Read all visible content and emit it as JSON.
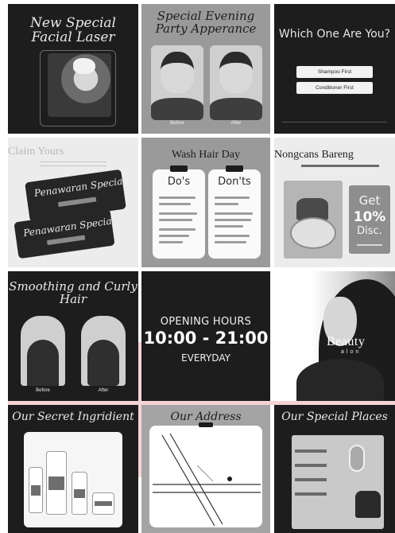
{
  "colors": {
    "dark_tile": "#1d1d1d",
    "mid_tile": "#9a9a9a",
    "light_tile": "#ececec",
    "accent_pink": "#f4d3d6"
  },
  "tiles": {
    "laser": {
      "title": "New Special Facial Laser"
    },
    "evening": {
      "title": "Special Evening Party Apperance",
      "before": "Before",
      "after": "After"
    },
    "which": {
      "title": "Which One Are You?",
      "option_1": "Shampoo First",
      "option_2": "Conditioner First"
    },
    "claim": {
      "title": "Claim Yours",
      "ticket_1": "Penawaran Special",
      "ticket_2": "Penawaran Special"
    },
    "washday": {
      "title": "Wash Hair Day",
      "dos": "Do's",
      "donts": "Don'ts"
    },
    "nongcans": {
      "title": "Nongcans Bareng",
      "get": "Get",
      "percent": "10%",
      "disc": "Disc."
    },
    "smoothing": {
      "title": "Smoothing and Curly Hair",
      "before": "Before",
      "after": "After"
    },
    "hours": {
      "label": "OPENING HOURS",
      "time": "10:00 - 21:00",
      "days": "EVERYDAY"
    },
    "brand": {
      "logo": "Beauty",
      "subline": "alon"
    },
    "ingredient": {
      "title": "Our Secret Ingridient"
    },
    "address": {
      "title": "Our Address"
    },
    "places": {
      "title": "Our Special Places"
    }
  }
}
